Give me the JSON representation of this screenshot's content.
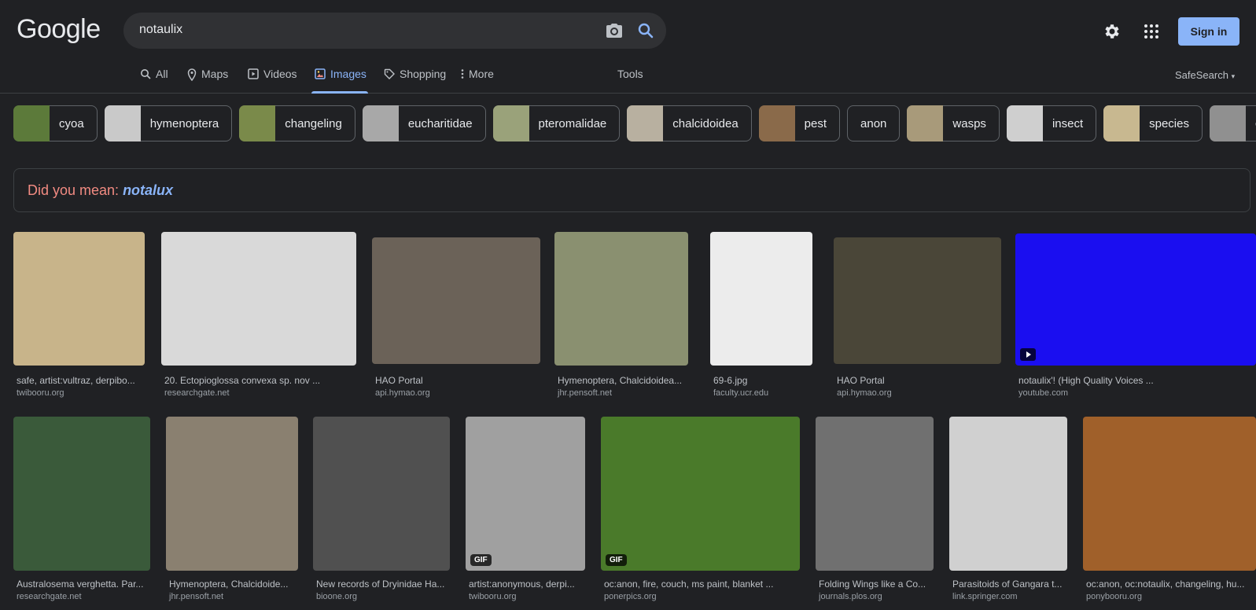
{
  "header": {
    "logo": "Google",
    "query": "notaulix",
    "signin": "Sign in"
  },
  "tabs": [
    {
      "label": "All"
    },
    {
      "label": "Maps"
    },
    {
      "label": "Videos"
    },
    {
      "label": "Images"
    },
    {
      "label": "Shopping"
    },
    {
      "label": "More"
    },
    {
      "label": "Tools"
    }
  ],
  "safesearch": "SafeSearch",
  "chips": [
    {
      "label": "cyoa",
      "color": "#5c7a3a"
    },
    {
      "label": "hymenoptera",
      "color": "#c9c9c9"
    },
    {
      "label": "changeling",
      "color": "#7a8a4a"
    },
    {
      "label": "eucharitidae",
      "color": "#a8a8a8"
    },
    {
      "label": "pteromalidae",
      "color": "#9aa27a"
    },
    {
      "label": "chalcidoidea",
      "color": "#b8b0a0"
    },
    {
      "label": "pest",
      "color": "#8a6a4a"
    },
    {
      "label": "anon",
      "color": ""
    },
    {
      "label": "wasps",
      "color": "#a89a7a"
    },
    {
      "label": "insect",
      "color": "#cfcfcf"
    },
    {
      "label": "species",
      "color": "#c8b890"
    },
    {
      "label": "chalcidoidea",
      "color": "#909090"
    }
  ],
  "did_you_mean": {
    "prefix": "Did you mean: ",
    "suggestion": "notalux"
  },
  "results_row1": [
    {
      "title": "safe, artist:vultraz, derpibo...",
      "site": "twibooru.org",
      "color": "#c8b48a",
      "badge": ""
    },
    {
      "title": "20. Ectopioglossa convexa sp. nov ...",
      "site": "researchgate.net",
      "color": "#d9d9d9",
      "badge": ""
    },
    {
      "title": "HAO Portal",
      "site": "api.hymao.org",
      "color": "#6b6258",
      "badge": ""
    },
    {
      "title": "Hymenoptera, Chalcidoidea...",
      "site": "jhr.pensoft.net",
      "color": "#8a9070",
      "badge": ""
    },
    {
      "title": "69-6.jpg",
      "site": "faculty.ucr.edu",
      "color": "#ececec",
      "badge": ""
    },
    {
      "title": "HAO Portal",
      "site": "api.hymao.org",
      "color": "#4a4638",
      "badge": ""
    },
    {
      "title": "notaulix'! (High Quality Voices ...",
      "site": "youtube.com",
      "color": "#1a0ef0",
      "badge": "play"
    }
  ],
  "results_row2": [
    {
      "title": "Australosema verghetta. Par...",
      "site": "researchgate.net",
      "color": "#3a5a3a",
      "badge": ""
    },
    {
      "title": "Hymenoptera, Chalcidoide...",
      "site": "jhr.pensoft.net",
      "color": "#8a8070",
      "badge": ""
    },
    {
      "title": "New records of Dryinidae Ha...",
      "site": "bioone.org",
      "color": "#505050",
      "badge": ""
    },
    {
      "title": "artist:anonymous, derpi...",
      "site": "twibooru.org",
      "color": "#a0a0a0",
      "badge": "GIF"
    },
    {
      "title": "oc:anon, fire, couch, ms paint, blanket ...",
      "site": "ponerpics.org",
      "color": "#4a7a2a",
      "badge": "GIF"
    },
    {
      "title": "Folding Wings like a Co...",
      "site": "journals.plos.org",
      "color": "#707070",
      "badge": ""
    },
    {
      "title": "Parasitoids of Gangara t...",
      "site": "link.springer.com",
      "color": "#d0d0d0",
      "badge": ""
    },
    {
      "title": "oc:anon, oc:notaulix, changeling, hu...",
      "site": "ponybooru.org",
      "color": "#a0602a",
      "badge": ""
    }
  ]
}
